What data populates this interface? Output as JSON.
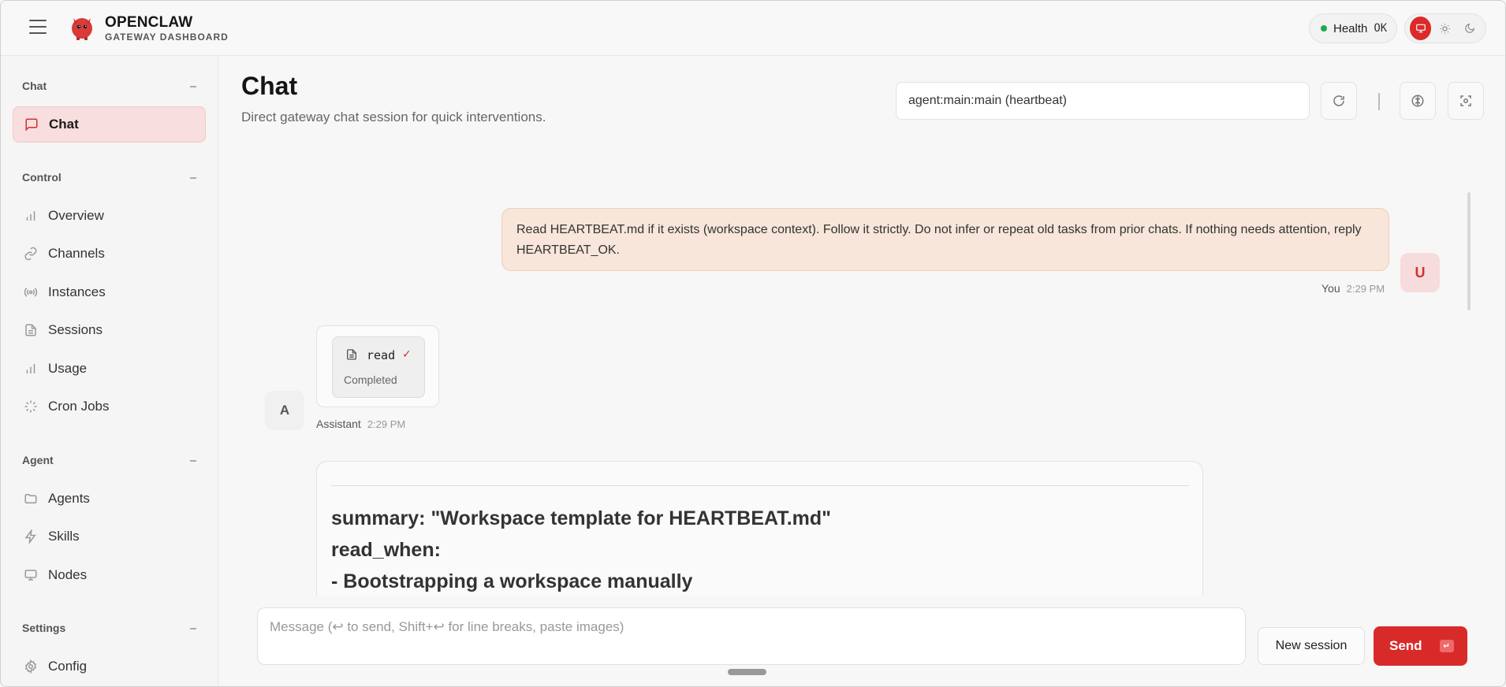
{
  "brand": {
    "title": "OPENCLAW",
    "subtitle": "GATEWAY DASHBOARD"
  },
  "health": {
    "label": "Health",
    "status": "OK",
    "status_color": "#22a94b"
  },
  "theme": {
    "options": [
      "system",
      "light",
      "dark"
    ],
    "active": "system",
    "accent": "#dc2a2a"
  },
  "sidebar": {
    "sections": [
      {
        "title": "Chat",
        "items": [
          {
            "label": "Chat",
            "icon": "message-icon",
            "active": true
          }
        ]
      },
      {
        "title": "Control",
        "items": [
          {
            "label": "Overview",
            "icon": "bar-chart-icon"
          },
          {
            "label": "Channels",
            "icon": "link-icon"
          },
          {
            "label": "Instances",
            "icon": "radio-icon"
          },
          {
            "label": "Sessions",
            "icon": "file-icon"
          },
          {
            "label": "Usage",
            "icon": "bar-chart-icon"
          },
          {
            "label": "Cron Jobs",
            "icon": "loader-icon"
          }
        ]
      },
      {
        "title": "Agent",
        "items": [
          {
            "label": "Agents",
            "icon": "folder-icon"
          },
          {
            "label": "Skills",
            "icon": "zap-icon"
          },
          {
            "label": "Nodes",
            "icon": "monitor-icon"
          }
        ]
      },
      {
        "title": "Settings",
        "items": [
          {
            "label": "Config",
            "icon": "gear-icon"
          }
        ]
      }
    ]
  },
  "main": {
    "title": "Chat",
    "subtitle": "Direct gateway chat session for quick interventions.",
    "session": "agent:main:main (heartbeat)"
  },
  "chat": {
    "user_message": "Read HEARTBEAT.md if it exists (workspace context). Follow it strictly. Do not infer or repeat old tasks from prior chats. If nothing needs attention, reply HEARTBEAT_OK.",
    "user_avatar": "U",
    "user_name": "You",
    "user_time": "2:29 PM",
    "tool": {
      "name": "read",
      "status": "Completed"
    },
    "assistant_avatar": "A",
    "assistant_name": "Assistant",
    "assistant_time": "2:29 PM",
    "doc_lines": [
      "summary: \"Workspace template for HEARTBEAT.md\"",
      "read_when:",
      "- Bootstrapping a workspace manually"
    ]
  },
  "composer": {
    "placeholder": "Message (↩ to send, Shift+↩ for line breaks, paste images)",
    "new_session": "New session",
    "send": "Send",
    "send_key": "↵"
  }
}
